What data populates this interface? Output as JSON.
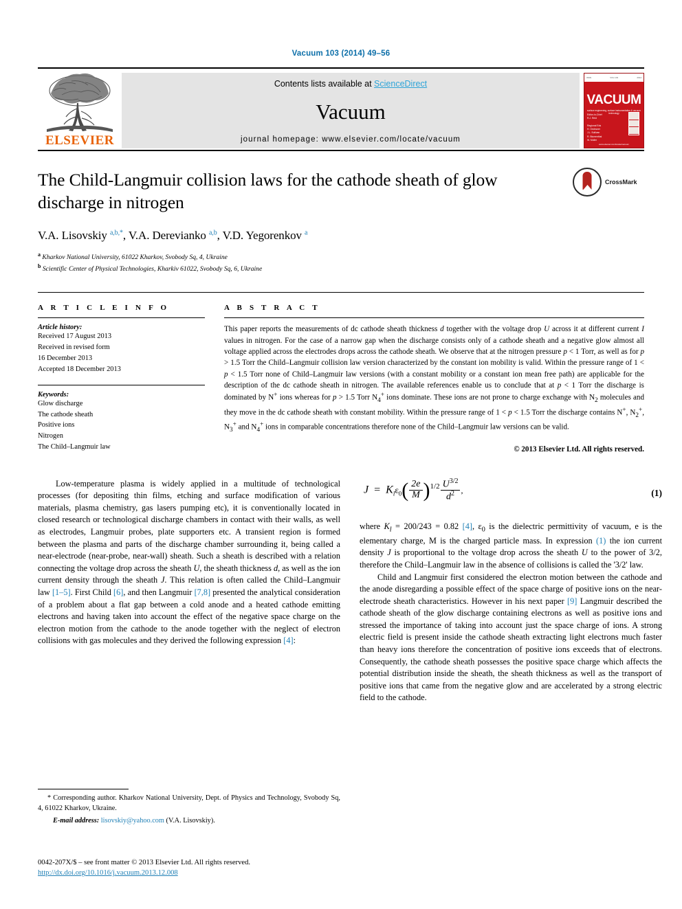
{
  "running_head": "Vacuum 103 (2014) 49–56",
  "masthead": {
    "publisher": "ELSEVIER",
    "contents_prefix": "Contents lists available at ",
    "contents_link": "ScienceDirect",
    "journal_name": "Vacuum",
    "homepage": "journal homepage: www.elsevier.com/locate/vacuum",
    "cover": {
      "title": "VACUUM",
      "subtitle": "surface engineering, surface instrumentation & vacuum technology",
      "editors": "Editor-in-Chief\nR.J. Reid\n\nRegional Editors\nH. Oechsner\nJ.L. Sullivan\nR. Blumenthal\nW. Moller\nD. Hoffman\nR.K. Wild",
      "footer": "www.elsevier.com/locate/vacuum"
    }
  },
  "crossmark": {
    "label": "CrossMark"
  },
  "title": "The Child-Langmuir collision laws for the cathode sheath of glow discharge in nitrogen",
  "authors_html": "V.A. Lisovskiy <sup>a,b,</sup><sup>*</sup>, V.A. Derevianko <sup>a,b</sup>, V.D. Yegorenkov <sup>a</sup>",
  "affiliations": [
    {
      "mark": "a",
      "text": "Kharkov National University, 61022 Kharkov, Svobody Sq, 4, Ukraine"
    },
    {
      "mark": "b",
      "text": "Scientific Center of Physical Technologies, Kharkiv 61022, Svobody Sq, 6, Ukraine"
    }
  ],
  "article_info": {
    "heading": "A R T I C L E  I N F O",
    "history_label": "Article history:",
    "history": [
      "Received 17 August 2013",
      "Received in revised form",
      "16 December 2013",
      "Accepted 18 December 2013"
    ],
    "keywords_label": "Keywords:",
    "keywords": [
      "Glow discharge",
      "The cathode sheath",
      "Positive ions",
      "Nitrogen",
      "The Child–Langmuir law"
    ]
  },
  "abstract": {
    "heading": "A B S T R A C T",
    "text_html": "This paper reports the measurements of dc cathode sheath thickness <i>d</i> together with the voltage drop <i>U</i> across it at different current <i>I</i> values in nitrogen. For the case of a narrow gap when the discharge consists only of a cathode sheath and a negative glow almost all voltage applied across the electrodes drops across the cathode sheath. We observe that at the nitrogen pressure <i>p</i> &lt; 1 Torr, as well as for <i>p</i> &gt; 1.5 Torr the Child–Langmuir collision law version characterized by the constant ion mobility is valid. Within the pressure range of 1 &lt; <i>p</i> &lt; 1.5 Torr none of Child–Langmuir law versions (with a constant mobility or a constant ion mean free path) are applicable for the description of the dc cathode sheath in nitrogen. The available references enable us to conclude that at <i>p</i> &lt; 1 Torr the discharge is dominated by N<sup>+</sup> ions whereas for <i>p</i> &gt; 1.5 Torr N<sub>4</sub><sup>+</sup> ions dominate. These ions are not prone to charge exchange with N<sub>2</sub> molecules and they move in the dc cathode sheath with constant mobility. Within the pressure range of 1 &lt; <i>p</i> &lt; 1.5 Torr the discharge contains N<sup>+</sup>, N<sub>2</sub><sup>+</sup>, N<sub>3</sub><sup>+</sup> and N<sub>4</sub><sup>+</sup> ions in comparable concentrations therefore none of the Child–Langmuir law versions can be valid.",
    "copyright": "© 2013 Elsevier Ltd. All rights reserved."
  },
  "body": {
    "left_paragraph_html": "Low-temperature plasma is widely applied in a multitude of technological processes (for depositing thin films, etching and surface modification of various materials, plasma chemistry, gas lasers pumping etc), it is conventionally located in closed research or technological discharge chambers in contact with their walls, as well as electrodes, Langmuir probes, plate supporters etc. A transient region is formed between the plasma and parts of the discharge chamber surrounding it, being called a near-electrode (near-probe, near-wall) sheath. Such a sheath is described with a relation connecting the voltage drop across the sheath <i>U</i>, the sheath thickness <i>d</i>, as well as the ion current density through the sheath <i>J</i>. This relation is often called the Child–Langmuir law <span class=\"ref\">[1–5]</span>. First Child <span class=\"ref\">[6]</span>, and then Langmuir <span class=\"ref\">[7,8]</span> presented the analytical consideration of a problem about a flat gap between a cold anode and a heated cathode emitting electrons and having taken into account the effect of the negative space charge on the electron motion from the cathode to the anode together with the neglect of electron collisions with gas molecules and they derived the following expression <span class=\"ref\">[4]</span>:",
    "equation_number": "(1)",
    "equation_parts": {
      "lhs": "J",
      "eq": "=",
      "coef": "K",
      "coef_sub": "l",
      "eps": "ε",
      "eps_sub": "0",
      "frac1_num": "2e",
      "frac1_den": "M",
      "exp1": "1/2",
      "frac2_num": "U",
      "frac2_num_exp": "3/2",
      "frac2_den": "d",
      "frac2_den_exp": "2",
      "trailer": ","
    },
    "right_paragraph1_html": "where <i>K<sub>l</sub></i> = 200/243 = 0.82 <span class=\"ref\">[4]</span>, ε<sub>0</sub> is the dielectric permittivity of vacuum, e is the elementary charge, M is the charged particle mass. In expression <span class=\"ref\">(1)</span> the ion current density <i>J</i> is proportional to the voltage drop across the sheath <i>U</i> to the power of 3/2, therefore the Child–Langmuir law in the absence of collisions is called the '3/2' law.",
    "right_paragraph2_html": "Child and Langmuir first considered the electron motion between the cathode and the anode disregarding a possible effect of the space charge of positive ions on the near-electrode sheath characteristics. However in his next paper <span class=\"ref\">[9]</span> Langmuir described the cathode sheath of the glow discharge containing electrons as well as positive ions and stressed the importance of taking into account just the space charge of ions. A strong electric field is present inside the cathode sheath extracting light electrons much faster than heavy ions therefore the concentration of positive ions exceeds that of electrons. Consequently, the cathode sheath possesses the positive space charge which affects the potential distribution inside the sheath, the sheath thickness as well as the transport of positive ions that came from the negative glow and are accelerated by a strong electric field to the cathode."
  },
  "footnote": {
    "corresponding_html": "* Corresponding author. Kharkov National University, Dept. of Physics and Technology, Svobody Sq, 4, 61022 Kharkov, Ukraine.",
    "email_label": "E-mail address:",
    "email": "lisovskiy@yahoo.com",
    "email_owner": "(V.A. Lisovskiy)."
  },
  "page_footer": {
    "issn_line": "0042-207X/$ – see front matter © 2013 Elsevier Ltd. All rights reserved.",
    "doi": "http://dx.doi.org/10.1016/j.vacuum.2013.12.008"
  },
  "colors": {
    "link": "#1f7fb5",
    "sciencedirect": "#2da4d8",
    "elsevier_orange": "#E8630A",
    "cover_red": "#c8151c"
  }
}
